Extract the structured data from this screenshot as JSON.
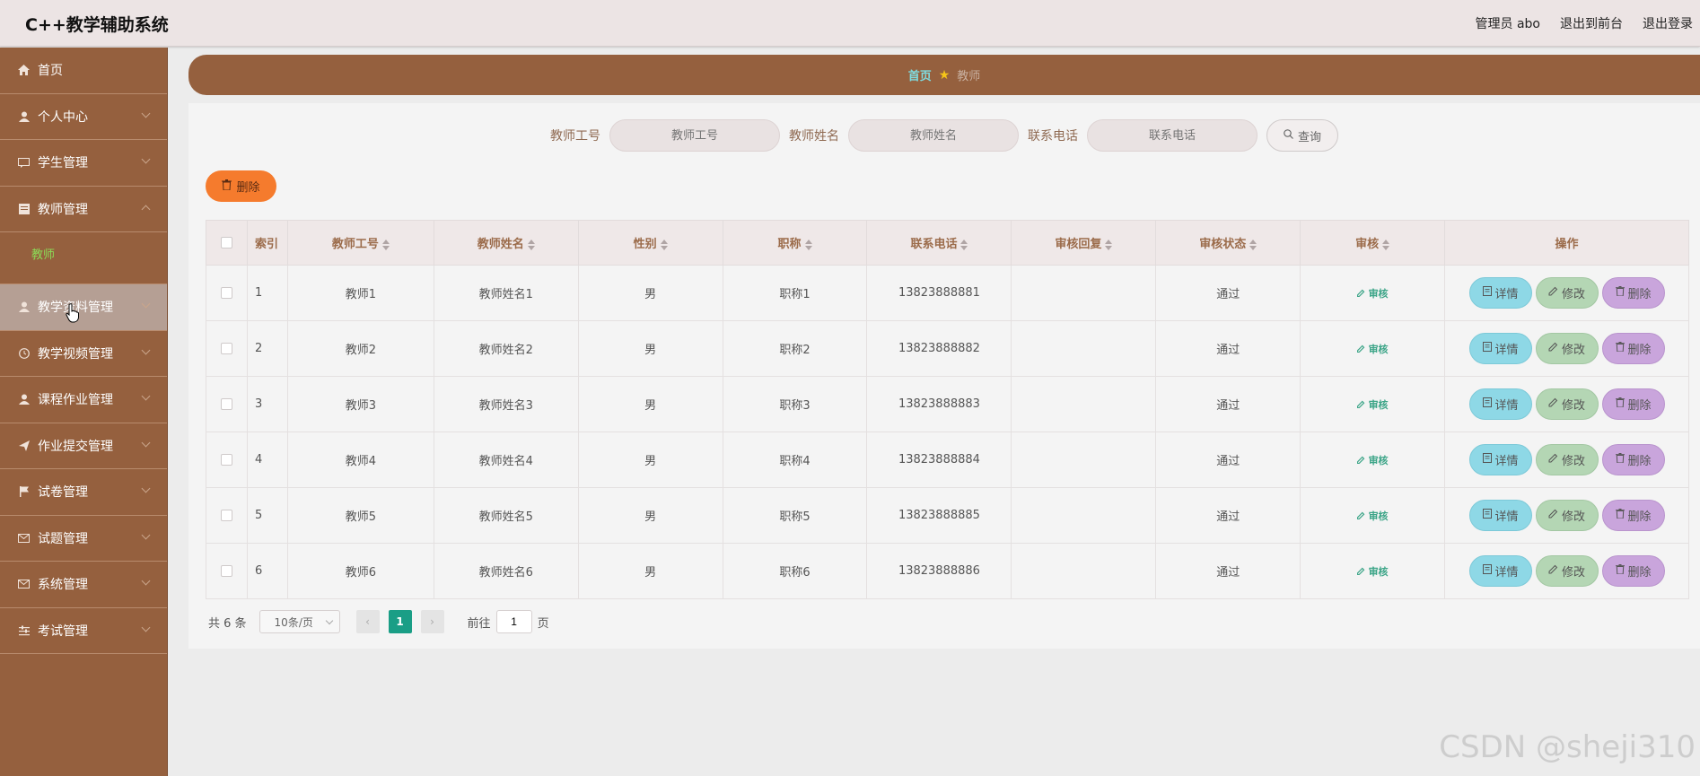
{
  "header": {
    "app_title": "C++教学辅助系统",
    "user_label": "管理员 abo",
    "to_front": "退出到前台",
    "logout": "退出登录"
  },
  "sidebar": {
    "items": [
      {
        "label": "首页",
        "icon": "home-icon"
      },
      {
        "label": "个人中心",
        "icon": "user-icon"
      },
      {
        "label": "学生管理",
        "icon": "chat-icon"
      },
      {
        "label": "教师管理",
        "icon": "document-icon"
      },
      {
        "label": "教学资料管理",
        "icon": "user-icon"
      },
      {
        "label": "教学视频管理",
        "icon": "clock-icon"
      },
      {
        "label": "课程作业管理",
        "icon": "user-icon"
      },
      {
        "label": "作业提交管理",
        "icon": "send-icon"
      },
      {
        "label": "试卷管理",
        "icon": "flag-icon"
      },
      {
        "label": "试题管理",
        "icon": "mail-icon"
      },
      {
        "label": "系统管理",
        "icon": "mail-icon"
      },
      {
        "label": "考试管理",
        "icon": "sliders-icon"
      }
    ],
    "submenu_teacher": "教师"
  },
  "breadcrumb": {
    "home": "首页",
    "current": "教师"
  },
  "search": {
    "id_label": "教师工号",
    "id_placeholder": "教师工号",
    "name_label": "教师姓名",
    "name_placeholder": "教师姓名",
    "phone_label": "联系电话",
    "phone_placeholder": "联系电话",
    "button": "查询"
  },
  "actions": {
    "delete": "删除"
  },
  "table": {
    "headers": {
      "index": "索引",
      "teacher_id": "教师工号",
      "teacher_name": "教师姓名",
      "gender": "性别",
      "title": "职称",
      "phone": "联系电话",
      "audit_reply": "审核回复",
      "audit_status": "审核状态",
      "audit": "审核",
      "ops": "操作"
    },
    "rows": [
      {
        "index": "1",
        "teacher_id": "教师1",
        "teacher_name": "教师姓名1",
        "gender": "男",
        "title": "职称1",
        "phone": "13823888881",
        "audit_reply": "",
        "audit_status": "通过",
        "audit": "审核"
      },
      {
        "index": "2",
        "teacher_id": "教师2",
        "teacher_name": "教师姓名2",
        "gender": "男",
        "title": "职称2",
        "phone": "13823888882",
        "audit_reply": "",
        "audit_status": "通过",
        "audit": "审核"
      },
      {
        "index": "3",
        "teacher_id": "教师3",
        "teacher_name": "教师姓名3",
        "gender": "男",
        "title": "职称3",
        "phone": "13823888883",
        "audit_reply": "",
        "audit_status": "通过",
        "audit": "审核"
      },
      {
        "index": "4",
        "teacher_id": "教师4",
        "teacher_name": "教师姓名4",
        "gender": "男",
        "title": "职称4",
        "phone": "13823888884",
        "audit_reply": "",
        "audit_status": "通过",
        "audit": "审核"
      },
      {
        "index": "5",
        "teacher_id": "教师5",
        "teacher_name": "教师姓名5",
        "gender": "男",
        "title": "职称5",
        "phone": "13823888885",
        "audit_reply": "",
        "audit_status": "通过",
        "audit": "审核"
      },
      {
        "index": "6",
        "teacher_id": "教师6",
        "teacher_name": "教师姓名6",
        "gender": "男",
        "title": "职称6",
        "phone": "13823888886",
        "audit_reply": "",
        "audit_status": "通过",
        "audit": "审核"
      }
    ],
    "op_detail": "详情",
    "op_edit": "修改",
    "op_delete": "删除"
  },
  "pagination": {
    "total": "共 6 条",
    "page_size": "10条/页",
    "current_page": "1",
    "goto_label": "前往",
    "goto_value": "1",
    "page_suffix": "页"
  },
  "watermark": "CSDN @sheji310",
  "colors": {
    "brand_brown": "#95603e",
    "delete_orange": "#f57b2d",
    "pager_active": "#1a9e86",
    "detail_btn": "#8ed8e6",
    "edit_btn": "#b4d6b4",
    "delete_btn": "#c9a5dc"
  }
}
